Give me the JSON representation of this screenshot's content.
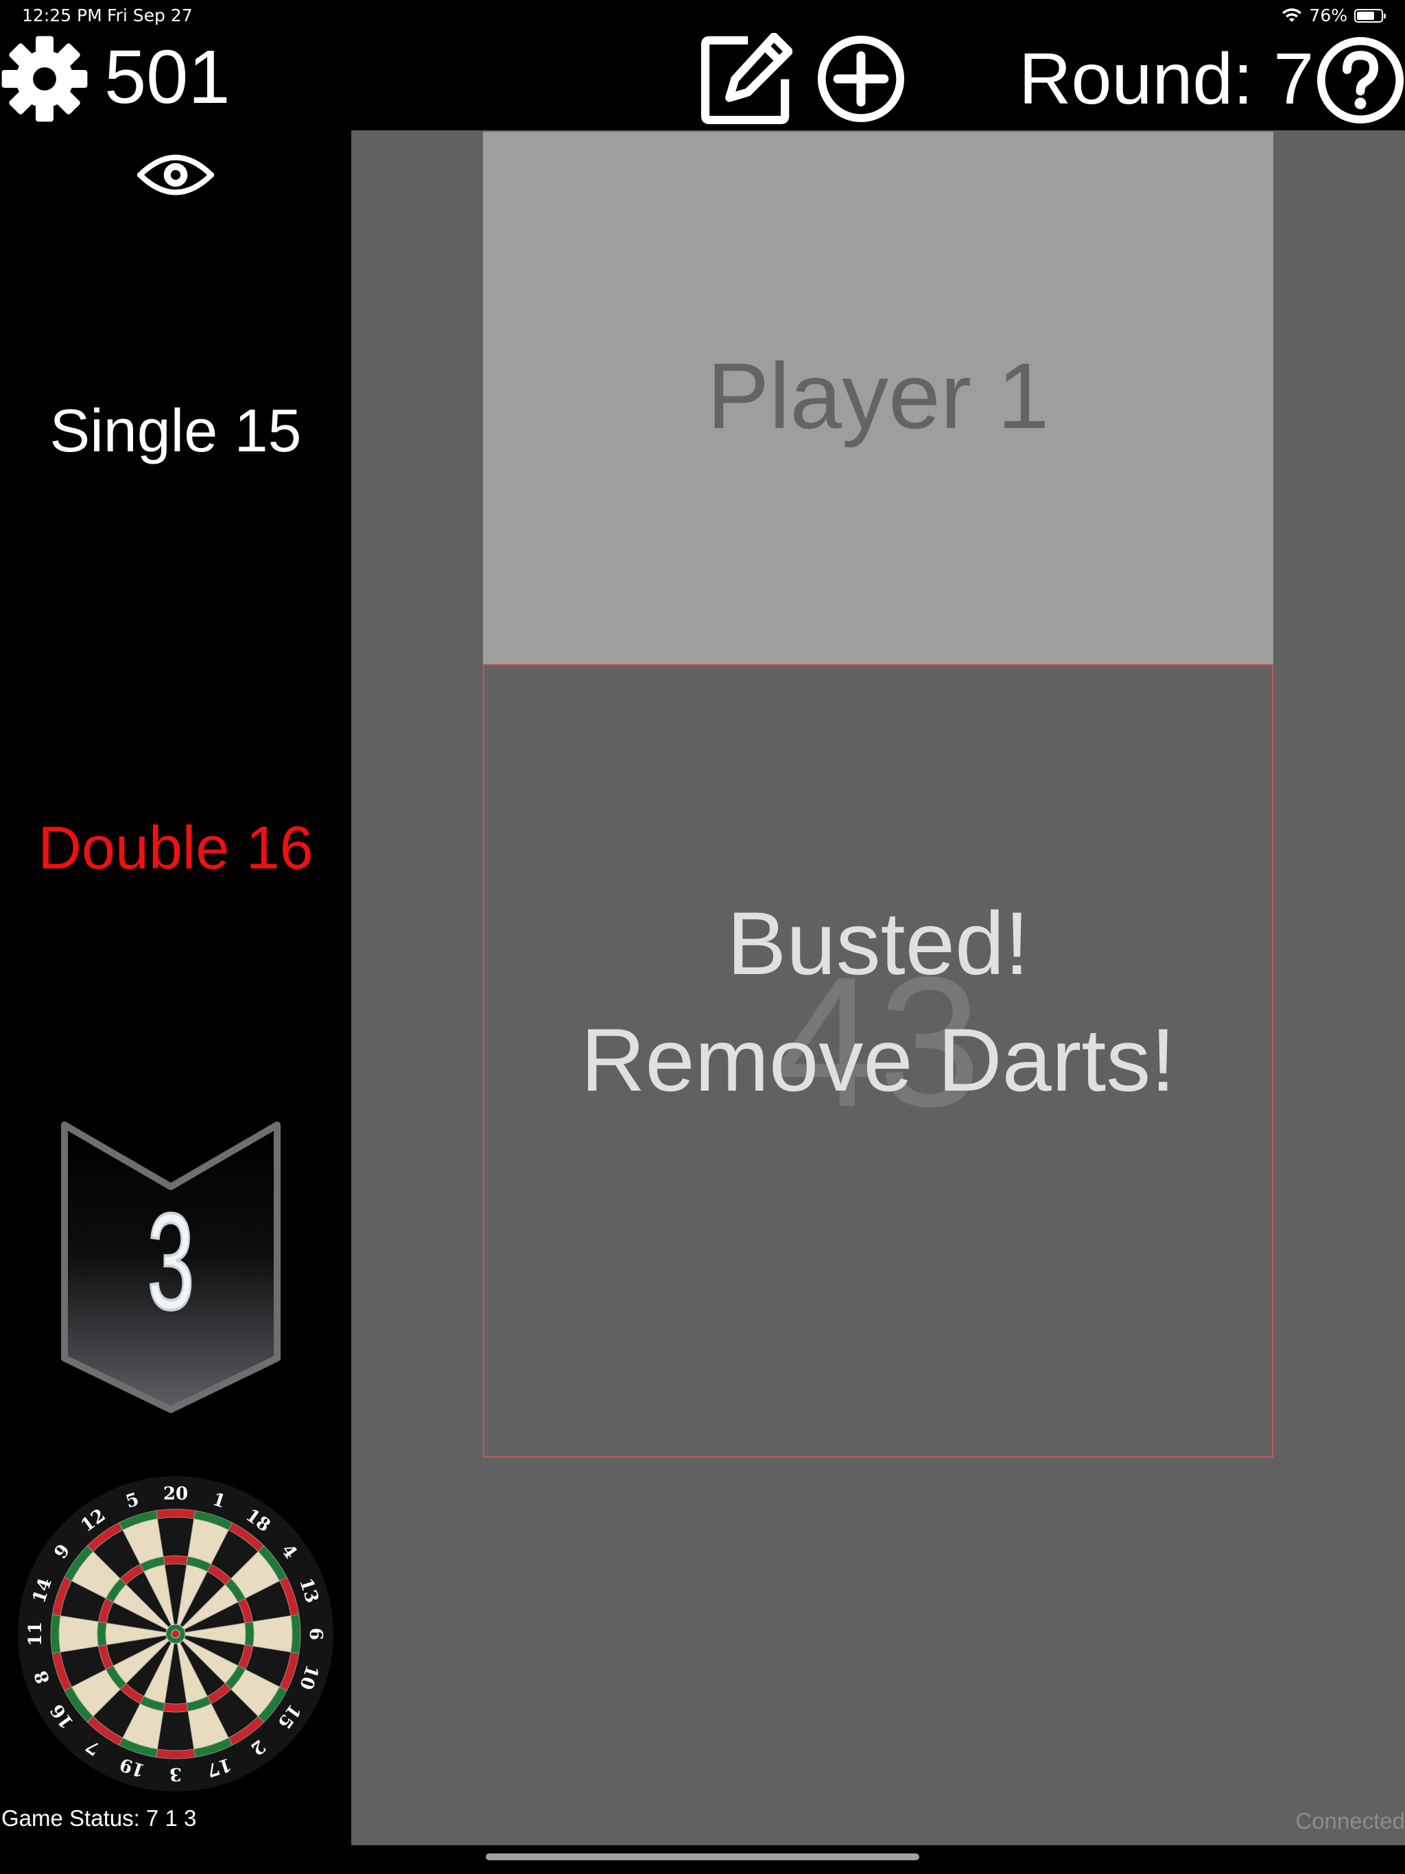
{
  "status_bar": {
    "time": "12:25 PM",
    "date": "Fri Sep 27",
    "battery": "76%",
    "battery_level": 0.76
  },
  "header": {
    "game_score": "501",
    "round_label": "Round: 7"
  },
  "icons": {
    "settings": "gear-icon",
    "edit": "edit-icon",
    "add": "plus-circle-icon",
    "help": "question-circle-icon",
    "visibility": "eye-icon"
  },
  "sidebar": {
    "dart_1": "Single 15",
    "dart_2": "Double 16",
    "darts_left": "3",
    "game_status": "Game Status: 7 1 3"
  },
  "dartboard": {
    "numbers": [
      "20",
      "1",
      "18",
      "4",
      "13",
      "6",
      "10",
      "15",
      "2",
      "17",
      "3",
      "19",
      "7",
      "16",
      "8",
      "11",
      "14",
      "9",
      "12",
      "5"
    ]
  },
  "main": {
    "player_name": "Player 1",
    "remaining_score": "43",
    "bust_line_1": "Busted!",
    "bust_line_2": "Remove Darts!",
    "connection_status": "Connected"
  },
  "colors": {
    "background": "#000000",
    "panel": "#616161",
    "player_card": "#9e9e9e",
    "double_red": "#ef1111",
    "score_card_border": "#c0595e"
  }
}
